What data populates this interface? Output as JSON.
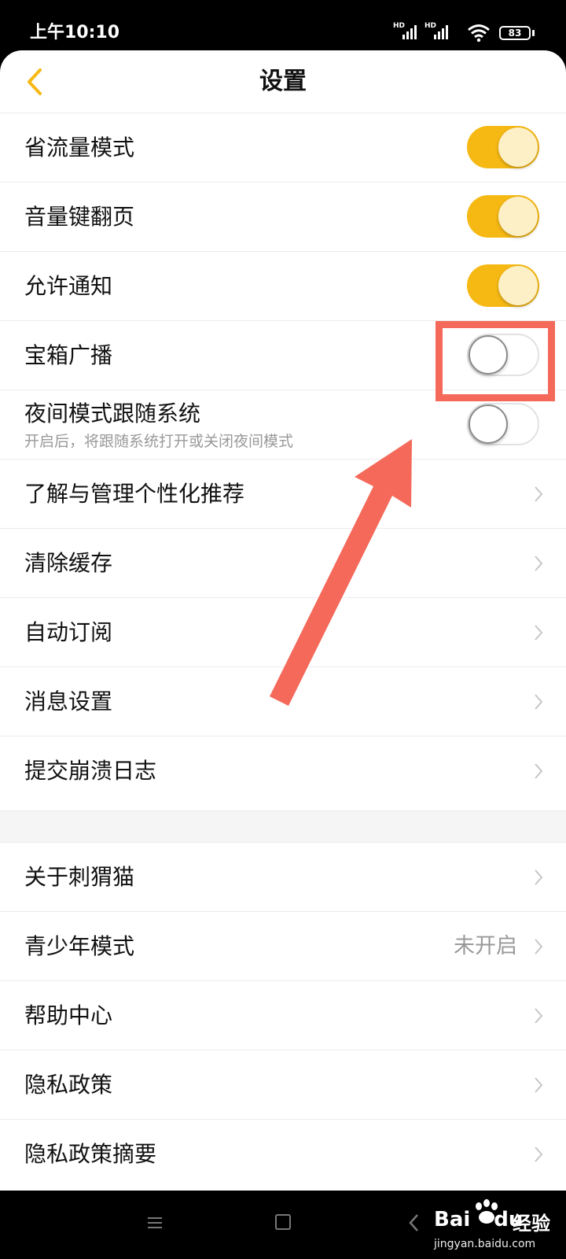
{
  "status_bar": {
    "time": "上午10:10",
    "signal_1_label": "HD",
    "signal_2_label": "HD",
    "battery": "83"
  },
  "header": {
    "title": "设置",
    "back_icon": "chevron-left-icon",
    "accent_color": "#f6b914"
  },
  "settings": {
    "toggles": [
      {
        "label": "省流量模式",
        "on": true
      },
      {
        "label": "音量键翻页",
        "on": true
      },
      {
        "label": "允许通知",
        "on": true
      },
      {
        "label": "宝箱广播",
        "on": false
      },
      {
        "label": "夜间模式跟随系统",
        "sublabel": "开启后，将跟随系统打开或关闭夜间模式",
        "on": false
      }
    ],
    "links": [
      {
        "label": "了解与管理个性化推荐"
      },
      {
        "label": "清除缓存"
      },
      {
        "label": "自动订阅"
      },
      {
        "label": "消息设置"
      },
      {
        "label": "提交崩溃日志"
      }
    ],
    "links2": [
      {
        "label": "关于刺猬猫"
      },
      {
        "label": "青少年模式",
        "value": "未开启"
      },
      {
        "label": "帮助中心"
      },
      {
        "label": "隐私政策"
      },
      {
        "label": "隐私政策摘要"
      }
    ]
  },
  "annotation_color": "#f4695a",
  "watermark": {
    "logo_bai": "Bai",
    "logo_du": "du",
    "jingyan": "经验",
    "url": "jingyan.baidu.com"
  }
}
